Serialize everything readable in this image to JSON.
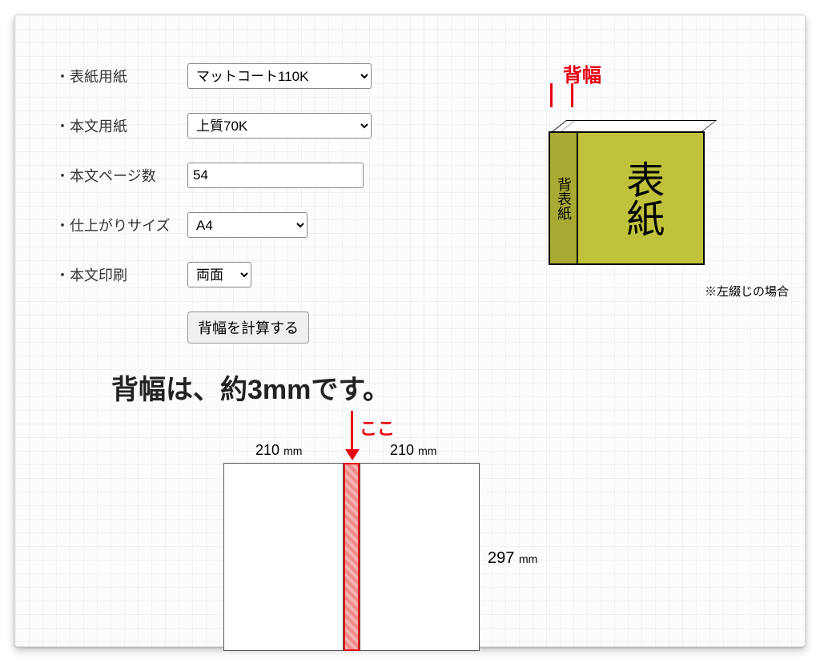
{
  "form": {
    "cover_paper": {
      "label": "・表紙用紙",
      "value": "マットコート110K"
    },
    "body_paper": {
      "label": "・本文用紙",
      "value": "上質70K"
    },
    "page_count": {
      "label": "・本文ページ数",
      "value": "54"
    },
    "finish_size": {
      "label": "・仕上がりサイズ",
      "value": "A4"
    },
    "body_print": {
      "label": "・本文印刷",
      "value": "両面"
    },
    "calc_button": "背幅を計算する"
  },
  "book_diagram": {
    "spine_label": "背幅",
    "front_cover_text": "表紙",
    "spine_text": "背表紙",
    "note": "※左綴じの場合"
  },
  "result": {
    "heading": "背幅は、約3mmです。"
  },
  "spread": {
    "here_label": "ここ",
    "width_value": "210",
    "width_unit": "mm",
    "height_value": "297",
    "height_unit": "mm"
  }
}
